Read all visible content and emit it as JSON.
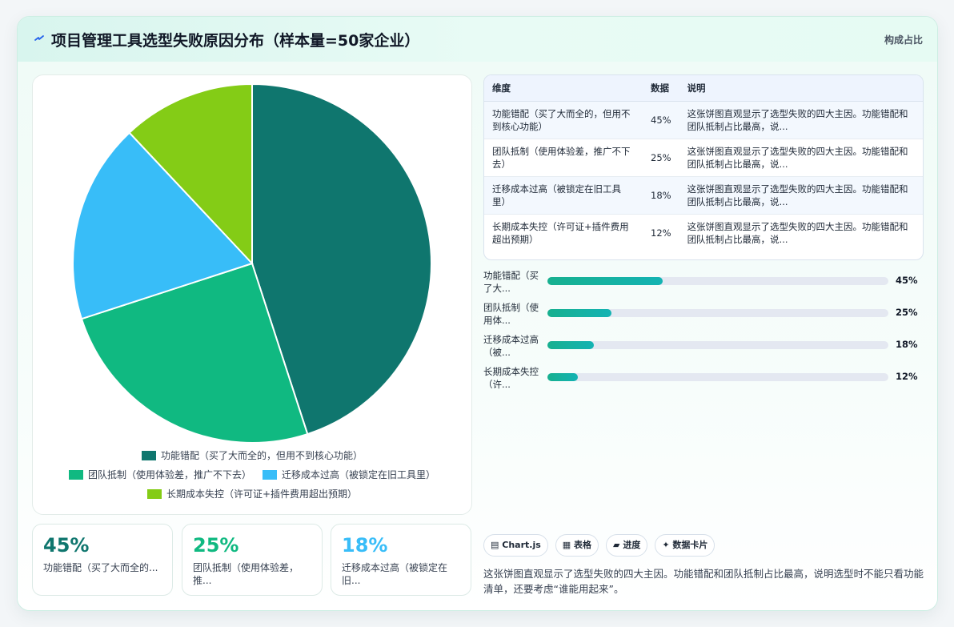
{
  "header": {
    "title": "项目管理工具选型失败原因分布（样本量=50家企业）",
    "right_label": "构成占比"
  },
  "colors": {
    "slice1": "#0f766e",
    "slice2": "#10b981",
    "slice3": "#38bdf8",
    "slice4": "#84cc16"
  },
  "chart_data": {
    "type": "pie",
    "categories": [
      "功能错配（买了大而全的，但用不到核心功能）",
      "团队抵制（使用体验差，推广不下去）",
      "迁移成本过高（被锁定在旧工具里）",
      "长期成本失控（许可证+插件费用超出预期）"
    ],
    "values": [
      45,
      25,
      18,
      12
    ],
    "unit": "%",
    "legend_position": "bottom"
  },
  "stats": [
    {
      "value": "45%",
      "label": "功能错配（买了大而全的..."
    },
    {
      "value": "25%",
      "label": "团队抵制（使用体验差，推..."
    },
    {
      "value": "18%",
      "label": "迁移成本过高（被锁定在旧..."
    }
  ],
  "table": {
    "headers": [
      "维度",
      "数据",
      "说明"
    ],
    "rows": [
      {
        "dim": "功能错配（买了大而全的，但用不到核心功能）",
        "val": "45%",
        "note": "这张饼图直观显示了选型失败的四大主因。功能错配和团队抵制占比最高，说..."
      },
      {
        "dim": "团队抵制（使用体验差，推广不下去）",
        "val": "25%",
        "note": "这张饼图直观显示了选型失败的四大主因。功能错配和团队抵制占比最高，说..."
      },
      {
        "dim": "迁移成本过高（被锁定在旧工具里）",
        "val": "18%",
        "note": "这张饼图直观显示了选型失败的四大主因。功能错配和团队抵制占比最高，说..."
      },
      {
        "dim": "长期成本失控（许可证+插件费用超出预期）",
        "val": "12%",
        "note": "这张饼图直观显示了选型失败的四大主因。功能错配和团队抵制占比最高，说..."
      }
    ]
  },
  "progress": [
    {
      "label": "功能错配（买了大...",
      "value": 45,
      "display": "45%"
    },
    {
      "label": "团队抵制（使用体...",
      "value": 25,
      "display": "25%"
    },
    {
      "label": "迁移成本过高（被...",
      "value": 18,
      "display": "18%"
    },
    {
      "label": "长期成本失控（许...",
      "value": 12,
      "display": "12%"
    }
  ],
  "tags": [
    {
      "icon": "▤",
      "label": "Chart.js"
    },
    {
      "icon": "▦",
      "label": "表格"
    },
    {
      "icon": "▰",
      "label": "进度"
    },
    {
      "icon": "✦",
      "label": "数据卡片"
    }
  ],
  "summary": "这张饼图直观显示了选型失败的四大主因。功能错配和团队抵制占比最高，说明选型时不能只看功能清单，还要考虑“谁能用起来”。"
}
